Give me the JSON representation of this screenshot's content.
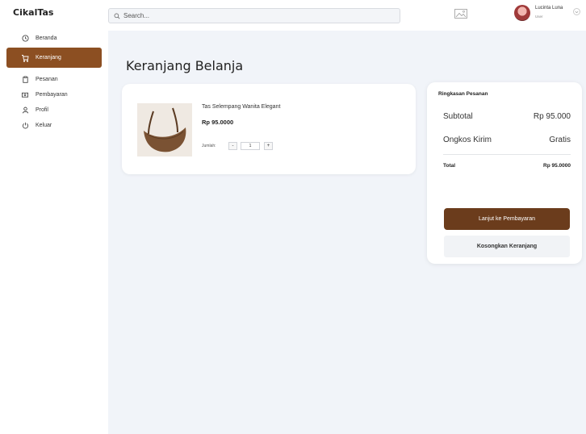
{
  "brand": "CikalTas",
  "sidebar": {
    "items": [
      {
        "label": "Beranda",
        "icon": "clock-icon"
      },
      {
        "label": "Keranjang",
        "icon": "cart-icon",
        "active": true
      },
      {
        "label": "Pesanan",
        "icon": "clipboard-icon"
      },
      {
        "label": "Pembayaran",
        "icon": "wallet-icon"
      },
      {
        "label": "Profil",
        "icon": "user-icon"
      },
      {
        "label": "Keluar",
        "icon": "power-icon"
      }
    ]
  },
  "header": {
    "search_placeholder": "Search...",
    "user_name": "Lucinta Luna",
    "user_role": "User"
  },
  "page_title": "Keranjang Belanja",
  "cart": {
    "items": [
      {
        "name": "Tas Selempang Wanita Elegant",
        "price": "Rp 95.0000",
        "qty_label": "Jumlah:",
        "qty": "1",
        "minus": "-",
        "plus": "+"
      }
    ]
  },
  "summary": {
    "title": "Ringkasan Pesanan",
    "subtotal_label": "Subtotal",
    "subtotal_value": "Rp 95.000",
    "shipping_label": "Ongkos Kirim",
    "shipping_value": "Gratis",
    "total_label": "Total",
    "total_value": "Rp 95.0000",
    "pay_button": "Lanjut ke Pembayaran",
    "clear_button": "Kosongkan Keranjang"
  },
  "colors": {
    "accent": "#8c4f22",
    "pay_button": "#6b3c1c",
    "background": "#f1f4f9"
  }
}
